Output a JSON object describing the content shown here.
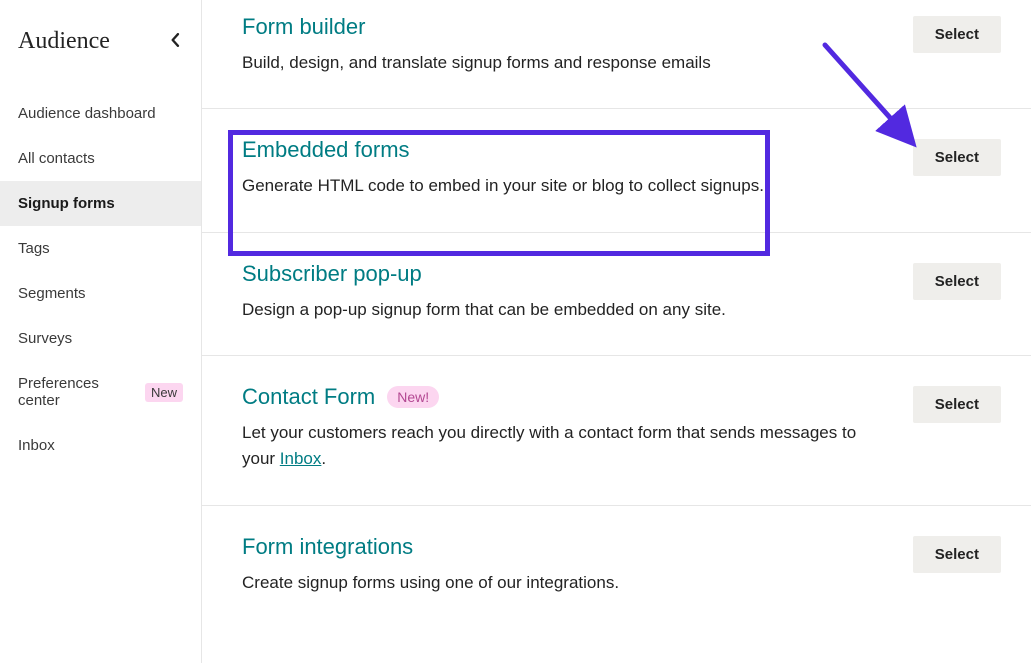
{
  "sidebar": {
    "title": "Audience",
    "items": [
      {
        "label": "Audience dashboard",
        "active": false,
        "new": false
      },
      {
        "label": "All contacts",
        "active": false,
        "new": false
      },
      {
        "label": "Signup forms",
        "active": true,
        "new": false
      },
      {
        "label": "Tags",
        "active": false,
        "new": false
      },
      {
        "label": "Segments",
        "active": false,
        "new": false
      },
      {
        "label": "Surveys",
        "active": false,
        "new": false
      },
      {
        "label": "Preferences center",
        "active": false,
        "new": true
      },
      {
        "label": "Inbox",
        "active": false,
        "new": false
      }
    ],
    "new_badge": "New"
  },
  "options": [
    {
      "title": "Form builder",
      "desc": "Build, design, and translate signup forms and response emails",
      "new": false
    },
    {
      "title": "Embedded forms",
      "desc": "Generate HTML code to embed in your site or blog to collect signups.",
      "new": false
    },
    {
      "title": "Subscriber pop-up",
      "desc": "Design a pop-up signup form that can be embedded on any site.",
      "new": false
    },
    {
      "title": "Contact Form",
      "desc_pre": "Let your customers reach you directly with a contact form that sends messages to your ",
      "desc_link": "Inbox",
      "desc_post": ".",
      "new": true
    },
    {
      "title": "Form integrations",
      "desc": "Create signup forms using one of our integrations.",
      "new": false
    }
  ],
  "buttons": {
    "select": "Select"
  },
  "badges": {
    "new_inline": "New!"
  }
}
